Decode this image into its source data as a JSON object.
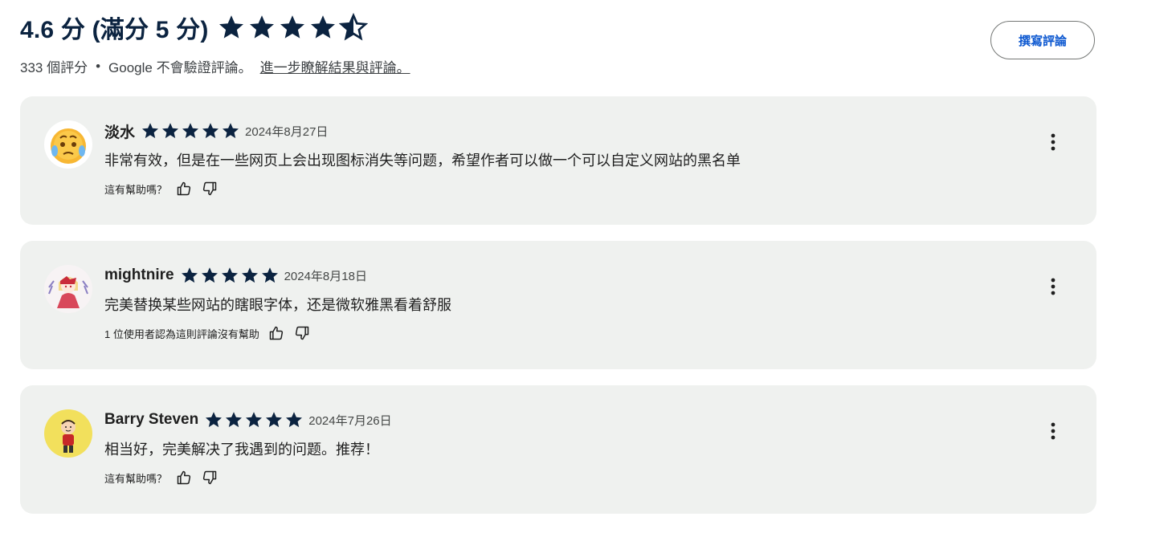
{
  "summary": {
    "rating_text": "4.6 分 (滿分 5 分)",
    "rating_value": 4.6,
    "count_text": "333 個評分",
    "separator": "•",
    "verify_text": "Google 不會驗證評論。",
    "learn_more": "進一步瞭解結果與評論。"
  },
  "write_review_label": "撰寫評論",
  "colors": {
    "star": "#0b2340",
    "accent": "#0b57d0",
    "card_bg": "#eff1ef"
  },
  "reviews": [
    {
      "author": "淡水",
      "rating": 5,
      "date": "2024年8月27日",
      "text": "非常有效，但是在一些网页上会出现图标消失等问题，希望作者可以做一个可以自定义网站的黑名单",
      "helpful_text": "這有幫助嗎？",
      "avatar_icon": "emoji-face-avatar"
    },
    {
      "author": "mightnire",
      "rating": 5,
      "date": "2024年8月18日",
      "text": "完美替换某些网站的瞎眼字体，还是微软雅黑看着舒服",
      "helpful_text": "1 位使用者認為這則評論沒有幫助",
      "avatar_icon": "anime-character-avatar"
    },
    {
      "author": "Barry Steven",
      "rating": 5,
      "date": "2024年7月26日",
      "text": "相当好，完美解决了我遇到的问题。推荐！",
      "helpful_text": "這有幫助嗎？",
      "avatar_icon": "cartoon-boy-avatar"
    }
  ]
}
